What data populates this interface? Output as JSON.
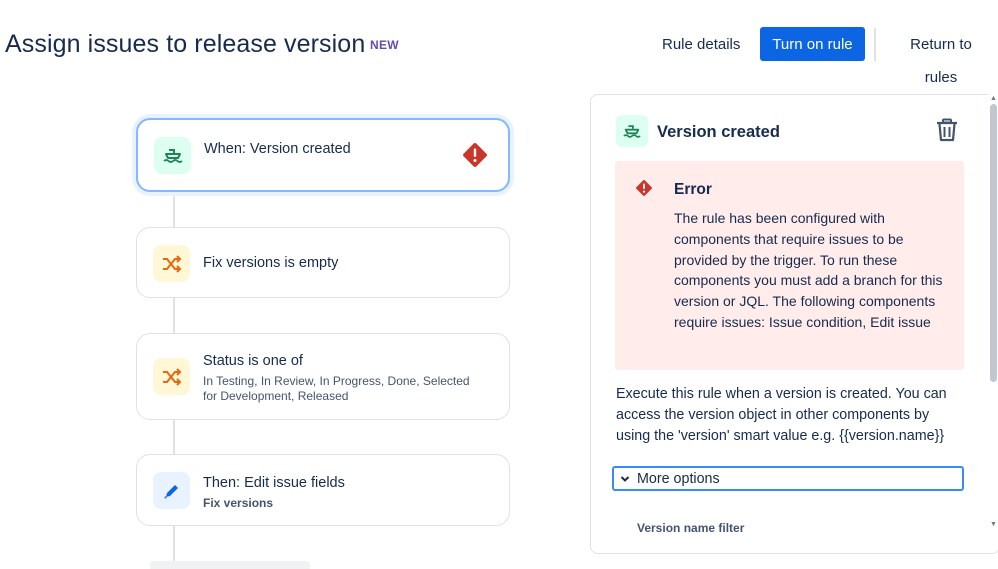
{
  "header": {
    "title": "Assign issues to release version",
    "badge": "NEW",
    "rule_details_label": "Rule details",
    "turn_on_label": "Turn on rule",
    "return_label": "Return to rules"
  },
  "flow": {
    "nodes": [
      {
        "title": "When: Version created",
        "subtitle": "",
        "icon": "ship-icon",
        "has_error": true
      },
      {
        "title": "Fix versions is empty",
        "subtitle": "",
        "icon": "shuffle-icon",
        "has_error": false
      },
      {
        "title": "Status is one of",
        "subtitle": "In Testing, In Review, In Progress, Done, Selected for Development, Released",
        "icon": "shuffle-icon",
        "has_error": false
      },
      {
        "title": "Then: Edit issue fields",
        "subtitle": "Fix versions",
        "icon": "pencil-icon",
        "has_error": false
      }
    ]
  },
  "panel": {
    "title": "Version created",
    "error": {
      "title": "Error",
      "message": "The rule has been configured with components that require issues to be provided by the trigger. To run these components you must add a branch for this version or JQL. The following components require issues: Issue condition, Edit issue"
    },
    "description": "Execute this rule when a version is created. You can access the version object in other components by using the 'version' smart value e.g. {{version.name}}",
    "more_options_label": "More options",
    "version_filter_label": "Version name filter"
  },
  "colors": {
    "primary": "#0c66e4",
    "error": "#c9372c",
    "error_bg": "#ffeceb",
    "trigger_icon": "#1f845a",
    "condition_icon": "#e56910",
    "action_icon": "#0c66e4"
  }
}
